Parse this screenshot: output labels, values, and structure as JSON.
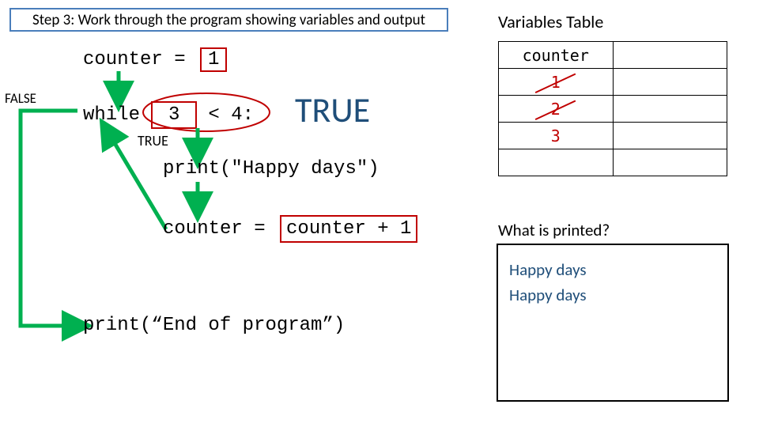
{
  "header": {
    "title": "Step 3: Work through the program showing variables and output"
  },
  "code": {
    "counter_assign_lhs": "counter =",
    "counter_assign_rhs": "1",
    "while_kw": "while",
    "while_val": "3",
    "while_cmp": "< 4:",
    "cond_result_big": "TRUE",
    "loop_back_label": "TRUE",
    "false_label": "FALSE",
    "print_happy": "print(\"Happy days\")",
    "incr_lhs": "counter =",
    "incr_rhs": "counter + 1",
    "end_print": "print(“End of program”)"
  },
  "vars_table": {
    "title": "Variables Table",
    "header": "counter",
    "rows": [
      {
        "val": "1",
        "strike": true
      },
      {
        "val": "2",
        "strike": true
      },
      {
        "val": "3",
        "strike": false,
        "current": true
      },
      {
        "val": "",
        "strike": false
      }
    ]
  },
  "output": {
    "question": "What is printed?",
    "lines": [
      "Happy days",
      "Happy days"
    ]
  }
}
